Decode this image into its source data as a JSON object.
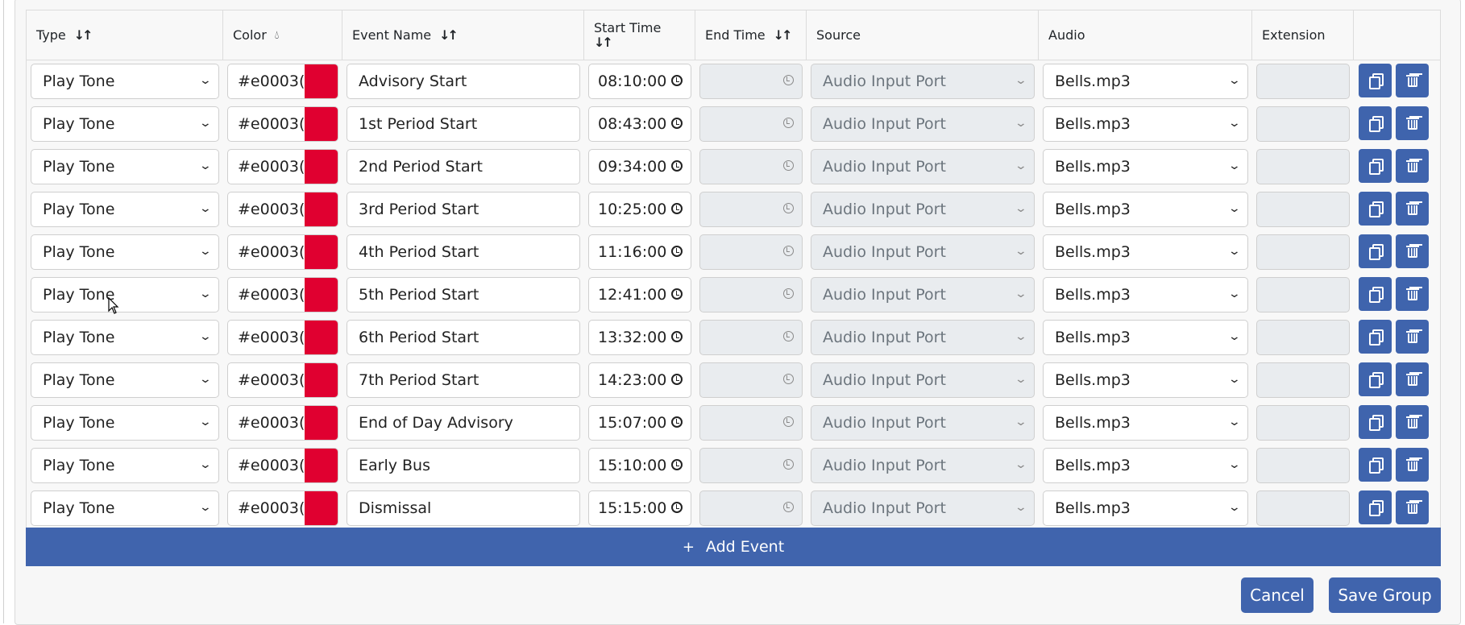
{
  "headers": {
    "type": "Type",
    "color": "Color",
    "event_name": "Event Name",
    "start_time": "Start Time",
    "end_time": "End Time",
    "source": "Source",
    "audio": "Audio",
    "extension": "Extension"
  },
  "icons": {
    "sort": "sort-icon",
    "color": "droplet-icon",
    "copy": "copy-icon",
    "delete": "trash-icon",
    "clock": "clock-icon",
    "chevron": "chevron-down-icon",
    "add": "plus-icon"
  },
  "colors": {
    "primary": "#4064ad",
    "swatch": "#e00030",
    "disabled": "#e9ecef"
  },
  "rows": [
    {
      "type": "Play Tone",
      "color_hex": "#e0003(",
      "event_name": "Advisory Start",
      "start_time": "08:10:00",
      "end_time": "",
      "source": "Audio Input Port",
      "audio": "Bells.mp3",
      "extension": ""
    },
    {
      "type": "Play Tone",
      "color_hex": "#e0003(",
      "event_name": "1st Period Start",
      "start_time": "08:43:00",
      "end_time": "",
      "source": "Audio Input Port",
      "audio": "Bells.mp3",
      "extension": ""
    },
    {
      "type": "Play Tone",
      "color_hex": "#e0003(",
      "event_name": "2nd Period Start",
      "start_time": "09:34:00",
      "end_time": "",
      "source": "Audio Input Port",
      "audio": "Bells.mp3",
      "extension": ""
    },
    {
      "type": "Play Tone",
      "color_hex": "#e0003(",
      "event_name": "3rd Period Start",
      "start_time": "10:25:00",
      "end_time": "",
      "source": "Audio Input Port",
      "audio": "Bells.mp3",
      "extension": ""
    },
    {
      "type": "Play Tone",
      "color_hex": "#e0003(",
      "event_name": "4th Period Start",
      "start_time": "11:16:00",
      "end_time": "",
      "source": "Audio Input Port",
      "audio": "Bells.mp3",
      "extension": ""
    },
    {
      "type": "Play Tone",
      "color_hex": "#e0003(",
      "event_name": "5th Period Start",
      "start_time": "12:41:00",
      "end_time": "",
      "source": "Audio Input Port",
      "audio": "Bells.mp3",
      "extension": ""
    },
    {
      "type": "Play Tone",
      "color_hex": "#e0003(",
      "event_name": "6th Period Start",
      "start_time": "13:32:00",
      "end_time": "",
      "source": "Audio Input Port",
      "audio": "Bells.mp3",
      "extension": ""
    },
    {
      "type": "Play Tone",
      "color_hex": "#e0003(",
      "event_name": "7th Period Start",
      "start_time": "14:23:00",
      "end_time": "",
      "source": "Audio Input Port",
      "audio": "Bells.mp3",
      "extension": ""
    },
    {
      "type": "Play Tone",
      "color_hex": "#e0003(",
      "event_name": "End of Day Advisory",
      "start_time": "15:07:00",
      "end_time": "",
      "source": "Audio Input Port",
      "audio": "Bells.mp3",
      "extension": ""
    },
    {
      "type": "Play Tone",
      "color_hex": "#e0003(",
      "event_name": "Early Bus",
      "start_time": "15:10:00",
      "end_time": "",
      "source": "Audio Input Port",
      "audio": "Bells.mp3",
      "extension": ""
    },
    {
      "type": "Play Tone",
      "color_hex": "#e0003(",
      "event_name": "Dismissal",
      "start_time": "15:15:00",
      "end_time": "",
      "source": "Audio Input Port",
      "audio": "Bells.mp3",
      "extension": ""
    }
  ],
  "add_event_label": "Add Event",
  "cancel_label": "Cancel",
  "save_label": "Save Group"
}
